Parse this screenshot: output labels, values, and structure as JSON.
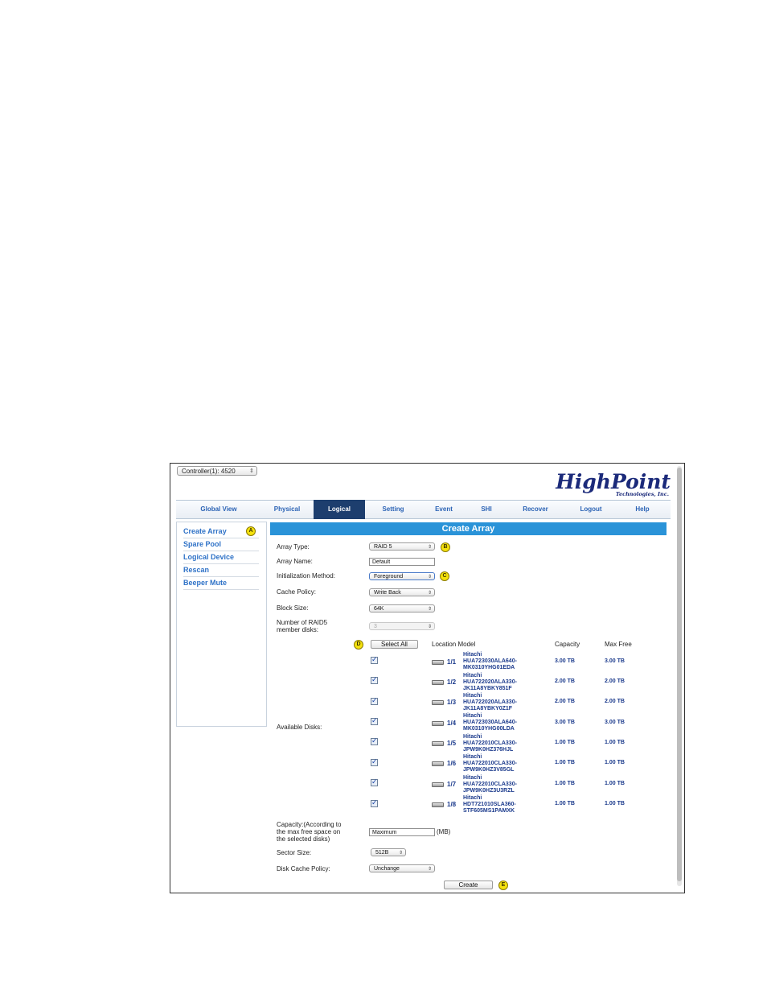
{
  "controller_select": {
    "value": "Controller(1): 4520"
  },
  "logo": {
    "brand": "HighPoint",
    "sub": "Technologies, Inc."
  },
  "nav": {
    "tabs": [
      {
        "label": "Global View",
        "active": false
      },
      {
        "label": "Physical",
        "active": false
      },
      {
        "label": "Logical",
        "active": true
      },
      {
        "label": "Setting",
        "active": false
      },
      {
        "label": "Event",
        "active": false
      },
      {
        "label": "SHI",
        "active": false
      },
      {
        "label": "Recover",
        "active": false
      },
      {
        "label": "Logout",
        "active": false
      },
      {
        "label": "Help",
        "active": false
      }
    ]
  },
  "sidebar": {
    "items": [
      {
        "label": "Create Array"
      },
      {
        "label": "Spare Pool"
      },
      {
        "label": "Logical Device"
      },
      {
        "label": "Rescan"
      },
      {
        "label": "Beeper Mute"
      }
    ]
  },
  "badges": {
    "a": "A",
    "b": "B",
    "c": "C",
    "d": "D",
    "e": "E"
  },
  "form": {
    "title": "Create Array",
    "array_type_label": "Array Type:",
    "array_type_value": "RAID 5",
    "array_name_label": "Array Name:",
    "array_name_value": "Default",
    "init_method_label": "Initialization Method:",
    "init_method_value": "Foreground",
    "cache_policy_label": "Cache Policy:",
    "cache_policy_value": "Write Back",
    "block_size_label": "Block Size:",
    "block_size_value": "64K",
    "member_disks_label_1": "Number of RAID5",
    "member_disks_label_2": "member disks:",
    "member_disks_value": "3",
    "select_all_label": "Select All",
    "available_disks_label": "Available Disks:",
    "col_location_model": "Location Model",
    "col_capacity": "Capacity",
    "col_max_free": "Max Free",
    "capacity_label_1": "Capacity:(According to",
    "capacity_label_2": "the max free space on",
    "capacity_label_3": "the selected disks)",
    "capacity_value": "Maximum",
    "capacity_unit": "(MB)",
    "sector_size_label": "Sector Size:",
    "sector_size_value": "512B",
    "disk_cache_label": "Disk Cache Policy:",
    "disk_cache_value": "Unchange",
    "create_label": "Create"
  },
  "disks": [
    {
      "location": "1/1",
      "vendor": "Hitachi",
      "model_1": "HUA723030ALA640-",
      "model_2": "MK0310YHG01EDA",
      "capacity": "3.00 TB",
      "max_free": "3.00 TB",
      "checked": true
    },
    {
      "location": "1/2",
      "vendor": "Hitachi",
      "model_1": "HUA722020ALA330-",
      "model_2": "JK11A8YBKY851F",
      "capacity": "2.00 TB",
      "max_free": "2.00 TB",
      "checked": true
    },
    {
      "location": "1/3",
      "vendor": "Hitachi",
      "model_1": "HUA722020ALA330-",
      "model_2": "JK11A8YBKY0Z1F",
      "capacity": "2.00 TB",
      "max_free": "2.00 TB",
      "checked": true
    },
    {
      "location": "1/4",
      "vendor": "Hitachi",
      "model_1": "HUA723030ALA640-",
      "model_2": "MK0310YHG00LDA",
      "capacity": "3.00 TB",
      "max_free": "3.00 TB",
      "checked": true
    },
    {
      "location": "1/5",
      "vendor": "Hitachi",
      "model_1": "HUA722010CLA330-",
      "model_2": "JPW9K0HZ376HJL",
      "capacity": "1.00 TB",
      "max_free": "1.00 TB",
      "checked": true
    },
    {
      "location": "1/6",
      "vendor": "Hitachi",
      "model_1": "HUA722010CLA330-",
      "model_2": "JPW9K0HZ3V85GL",
      "capacity": "1.00 TB",
      "max_free": "1.00 TB",
      "checked": true
    },
    {
      "location": "1/7",
      "vendor": "Hitachi",
      "model_1": "HUA722010CLA330-",
      "model_2": "JPW9K0HZ3U3RZL",
      "capacity": "1.00 TB",
      "max_free": "1.00 TB",
      "checked": true
    },
    {
      "location": "1/8",
      "vendor": "Hitachi",
      "model_1": "HDT721010SLA360-",
      "model_2": "STF605MS1PAMXK",
      "capacity": "1.00 TB",
      "max_free": "1.00 TB",
      "checked": true
    }
  ]
}
